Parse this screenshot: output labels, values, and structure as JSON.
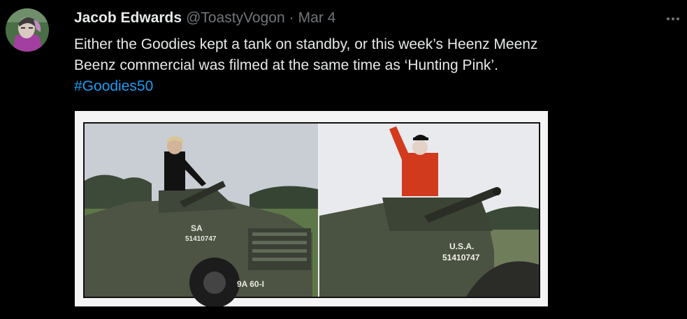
{
  "tweet": {
    "author_name": "Jacob Edwards",
    "handle": "@ToastyVogon",
    "separator": "·",
    "date": "Mar 4",
    "text_line1": "Either the Goodies kept a tank on standby, or this week’s Heenz Meenz",
    "text_line2": "Beenz commercial was filmed at the same time as ‘Hunting Pink’.",
    "hashtag": "#Goodies50"
  },
  "media": {
    "left_panel": {
      "vehicle_markings": [
        "SA",
        "51410747",
        "9A 60-I"
      ]
    },
    "right_panel": {
      "vehicle_markings": [
        "U.S.A.",
        "51410747"
      ]
    }
  },
  "icons": {
    "more": "more-horizontal-icon"
  },
  "colors": {
    "background": "#000000",
    "text": "#e7e9ea",
    "secondary": "#71767b",
    "link": "#1d9bf0"
  }
}
